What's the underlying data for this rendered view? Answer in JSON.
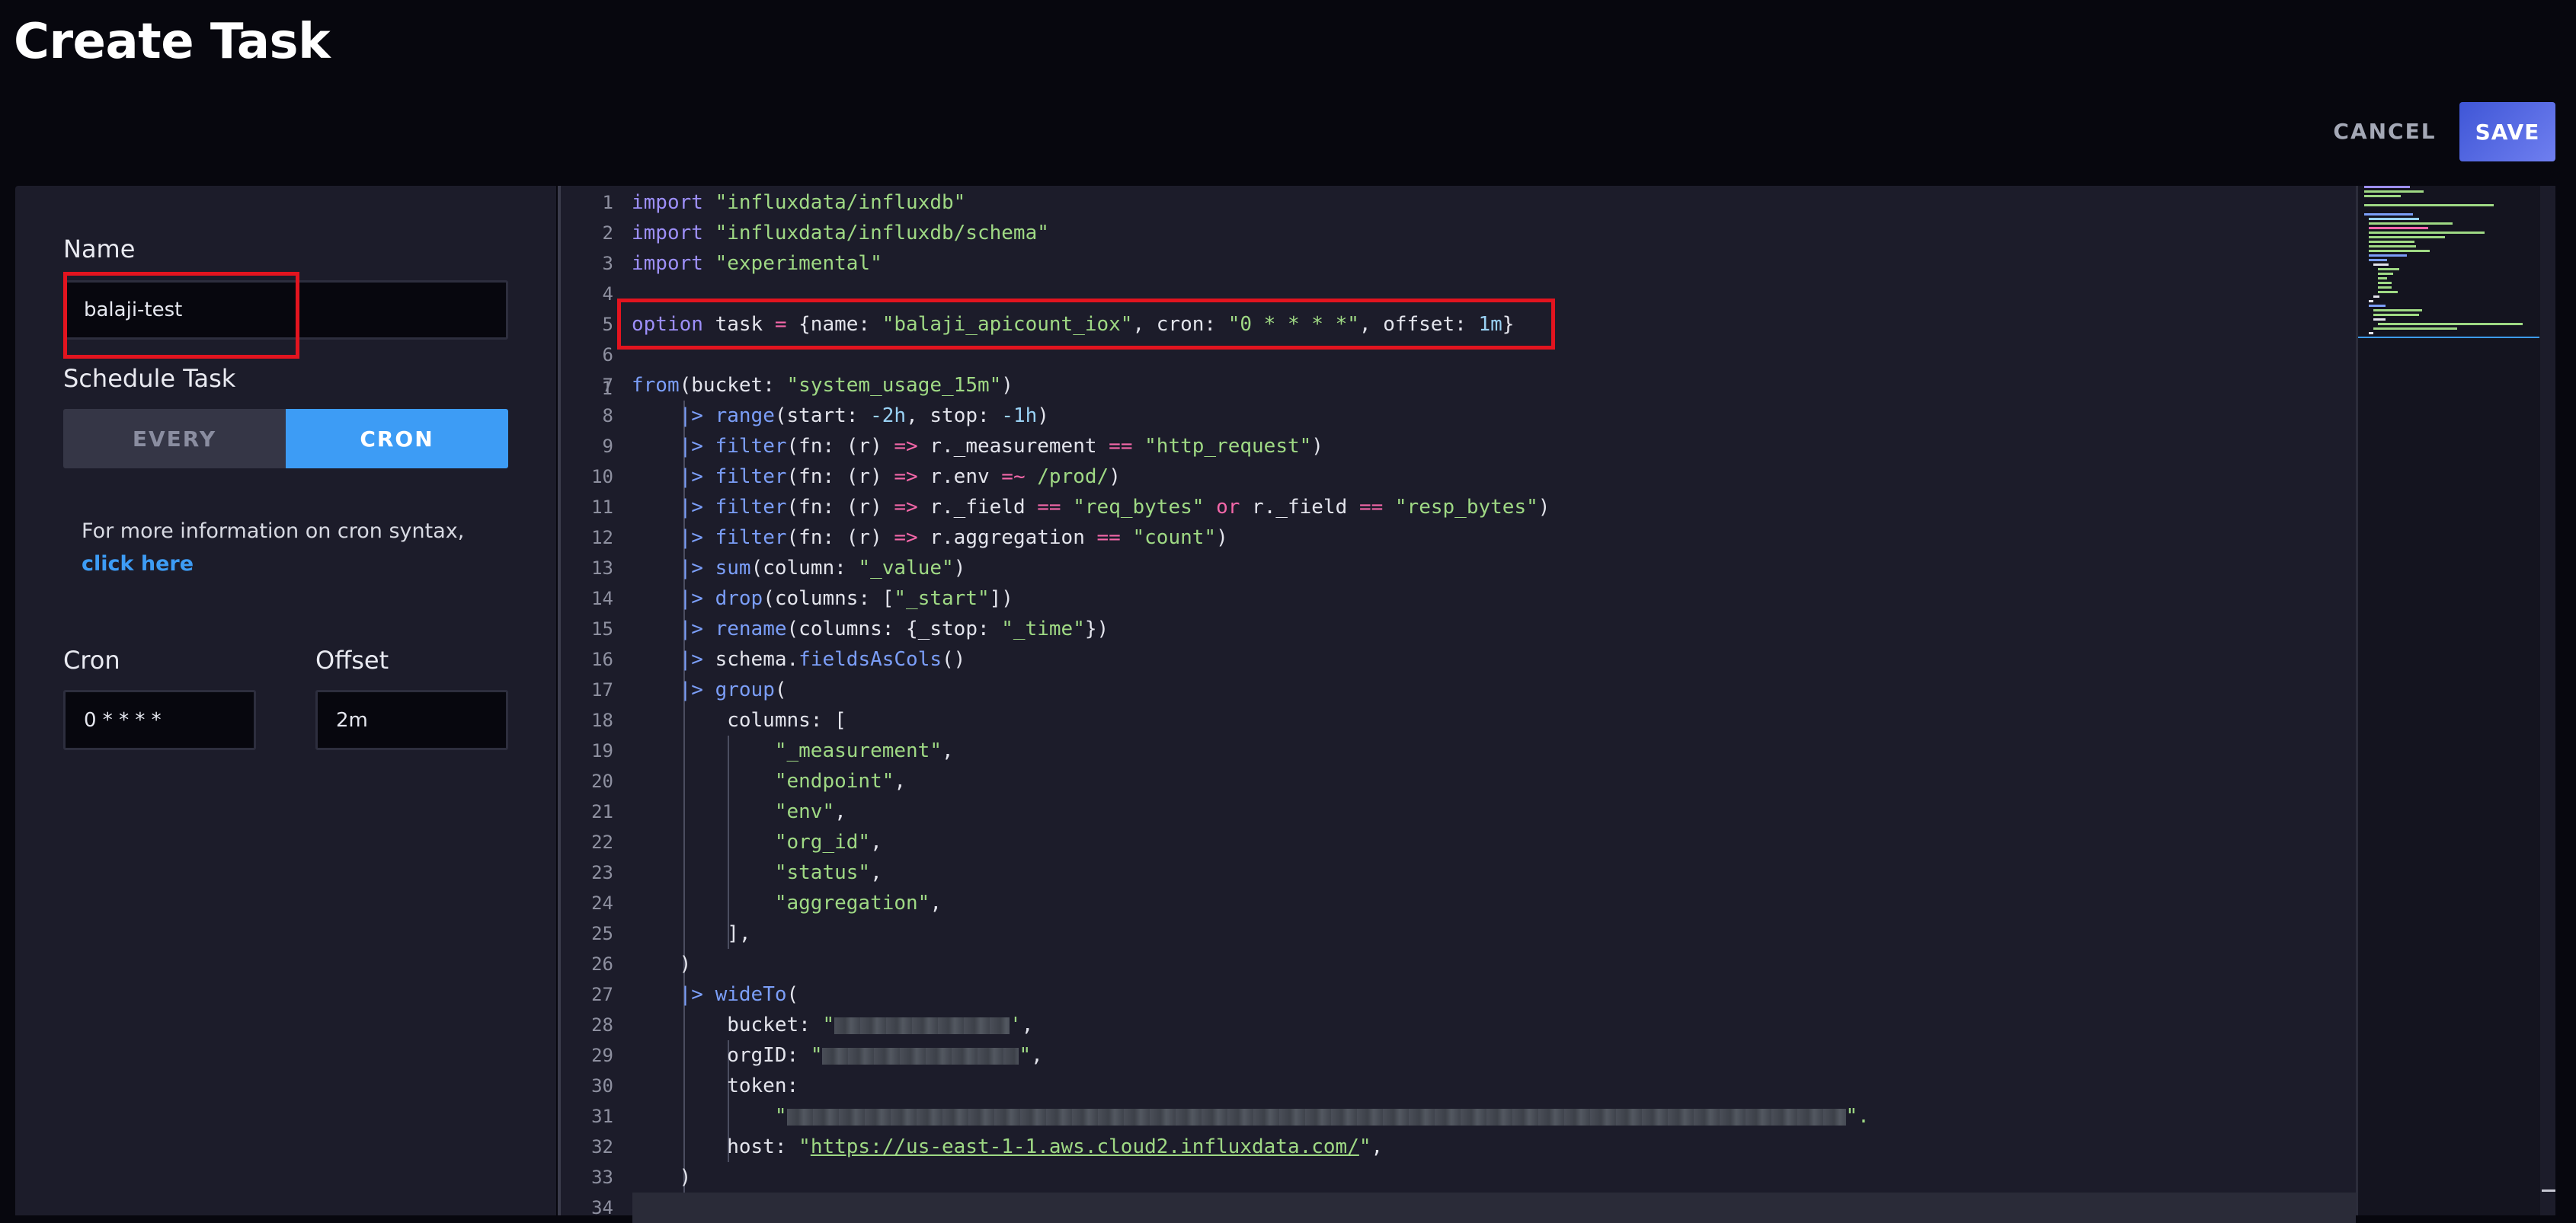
{
  "page": {
    "title": "Create Task"
  },
  "actions": {
    "cancel_label": "CANCEL",
    "save_label": "SAVE"
  },
  "form": {
    "name_label": "Name",
    "name_value": "balaji-test",
    "schedule_label": "Schedule Task",
    "schedule_options": [
      "EVERY",
      "CRON"
    ],
    "schedule_selected": "CRON",
    "help_text": "For more information on cron syntax, ",
    "help_link": "click here",
    "cron_label": "Cron",
    "cron_value": "0 * * * *",
    "offset_label": "Offset",
    "offset_value": "2m"
  },
  "editor": {
    "line_numbers": [
      "1",
      "2",
      "3",
      "4",
      "5",
      "6",
      "7",
      "8",
      "9",
      "10",
      "11",
      "12",
      "13",
      "14",
      "15",
      "16",
      "17",
      "18",
      "19",
      "20",
      "21",
      "22",
      "23",
      "24",
      "25",
      "26",
      "27",
      "28",
      "29",
      "30",
      "31",
      "32",
      "33",
      "34"
    ],
    "lines": [
      "import \"influxdata/influxdb\"",
      "import \"influxdata/influxdb/schema\"",
      "import \"experimental\"",
      "",
      "option task = {name: \"balaji_apicount_iox\", cron: \"0 * * * *\", offset: 1m}",
      "",
      "from(bucket: \"system_usage_15m\")",
      "    |> range(start: -2h, stop: -1h)",
      "    |> filter(fn: (r) => r._measurement == \"http_request\")",
      "    |> filter(fn: (r) => r.env =~ /prod/)",
      "    |> filter(fn: (r) => r._field == \"req_bytes\" or r._field == \"resp_bytes\")",
      "    |> filter(fn: (r) => r.aggregation == \"count\")",
      "    |> sum(column: \"_value\")",
      "    |> drop(columns: [\"_start\"])",
      "    |> rename(columns: {_stop: \"_time\"})",
      "    |> schema.fieldsAsCols()",
      "    |> group(",
      "        columns: [",
      "            \"_measurement\",",
      "            \"endpoint\",",
      "            \"env\",",
      "            \"org_id\",",
      "            \"status\",",
      "            \"aggregation\",",
      "        ],",
      "    )",
      "    |> wideTo(",
      "        bucket: \"[redacted]\",",
      "        orgID: \"[redacted]\",",
      "        token:",
      "            \"[redacted]\",",
      "        host: \"https://us-east-1-1.aws.cloud2.influxdata.com/\",",
      "    )",
      ""
    ],
    "tokens": {
      "import": "import",
      "pkg1": "\"influxdata/influxdb\"",
      "pkg2": "\"influxdata/influxdb/schema\"",
      "pkg3": "\"experimental\"",
      "option": "option",
      "task_name": "\"balaji_apicount_iox\"",
      "task_cron": "\"0 * * * *\"",
      "task_offset": "1m",
      "bucket_name": "\"system_usage_15m\"",
      "range_start": "-2h",
      "range_stop": "-1h",
      "measurement": "\"http_request\"",
      "env_regex": "/prod/",
      "field_req": "\"req_bytes\"",
      "field_resp": "\"resp_bytes\"",
      "agg_count": "\"count\"",
      "col_value": "\"_value\"",
      "col_start": "\"_start\"",
      "col_time": "\"_time\"",
      "g_measurement": "\"_measurement\"",
      "g_endpoint": "\"endpoint\"",
      "g_env": "\"env\"",
      "g_org": "\"org_id\"",
      "g_status": "\"status\"",
      "g_aggregation": "\"aggregation\"",
      "host_url": "https://us-east-1-1.aws.cloud2.influxdata.com/"
    }
  },
  "colors": {
    "background": "#07070e",
    "panel": "#1c1c2a",
    "accent": "#3d9cf5",
    "save_gradient_start": "#3f56d6",
    "highlight": "#e2141f"
  }
}
